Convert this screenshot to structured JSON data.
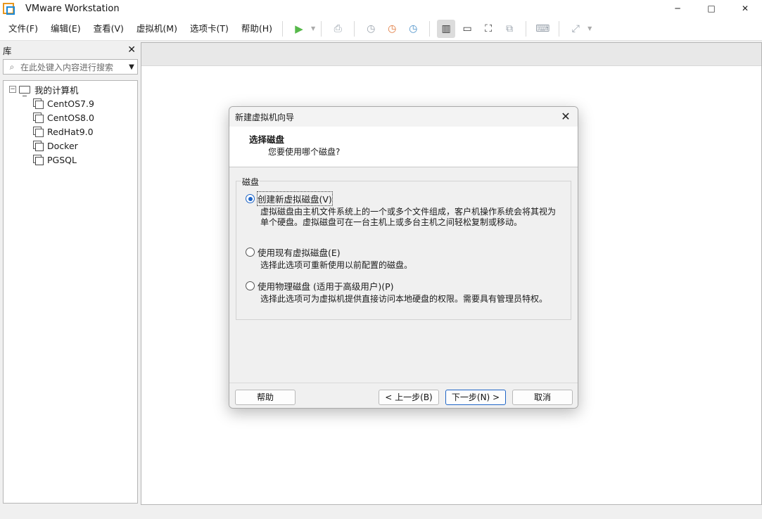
{
  "window": {
    "title": "VMware Workstation",
    "minimize": "─",
    "maximize": "□",
    "close": "✕"
  },
  "menu": [
    "文件(F)",
    "编辑(E)",
    "查看(V)",
    "虚拟机(M)",
    "选项卡(T)",
    "帮助(H)"
  ],
  "library": {
    "title": "库",
    "close": "✕",
    "search_placeholder": "在此处键入内容进行搜索",
    "tree_toggle": "−",
    "root": "我的计算机",
    "vms": [
      {
        "name": "CentOS7.9",
        "type": "vm"
      },
      {
        "name": "CentOS8.0",
        "type": "vm"
      },
      {
        "name": "RedHat9.0",
        "type": "vm"
      },
      {
        "name": "Docker",
        "type": "shared"
      },
      {
        "name": "PGSQL",
        "type": "shared"
      }
    ]
  },
  "dialog": {
    "title": "新建虚拟机向导",
    "close": "✕",
    "heading": "选择磁盘",
    "subheading": "您要使用哪个磁盘?",
    "group_title": "磁盘",
    "options": [
      {
        "label": "创建新虚拟磁盘(V)",
        "checked": true,
        "description": "虚拟磁盘由主机文件系统上的一个或多个文件组成，客户机操作系统会将其视为单个硬盘。虚拟磁盘可在一台主机上或多台主机之间轻松复制或移动。"
      },
      {
        "label": "使用现有虚拟磁盘(E)",
        "checked": false,
        "description": "选择此选项可重新使用以前配置的磁盘。"
      },
      {
        "label": "使用物理磁盘 (适用于高级用户)(P)",
        "checked": false,
        "description": "选择此选项可为虚拟机提供直接访问本地硬盘的权限。需要具有管理员特权。"
      }
    ],
    "buttons": {
      "help": "帮助",
      "back": "< 上一步(B)",
      "next": "下一步(N) >",
      "cancel": "取消"
    }
  },
  "colors": {
    "accent": "#1e65c7",
    "play": "#56b84a"
  }
}
